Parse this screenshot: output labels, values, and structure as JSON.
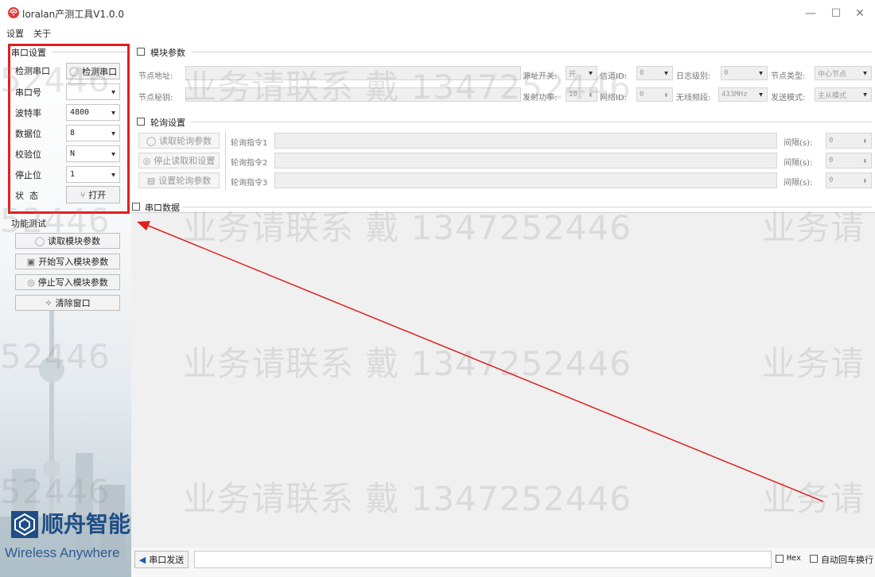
{
  "window": {
    "title": "loralan产测工具V1.0.0",
    "accent": "#e02020"
  },
  "menu": {
    "items": [
      "设置",
      "关于"
    ]
  },
  "serial_settings": {
    "title": "串口设置",
    "detect_label": "检测串口",
    "detect_button": "检测串口",
    "port_label": "串口号",
    "port_value": "",
    "baud_label": "波特率",
    "baud_value": "4800",
    "databits_label": "数据位",
    "databits_value": "8",
    "parity_label": "校验位",
    "parity_value": "N",
    "stopbits_label": "停止位",
    "stopbits_value": "1",
    "status_label": "状  态",
    "open_button": "打开"
  },
  "function_test": {
    "title": "功能测试",
    "read_params": "读取模块参数",
    "start_write": "开始写入模块参数",
    "stop_write": "停止写入模块参数",
    "clear_window": "清除窗口"
  },
  "module_params": {
    "title": "模块参数",
    "node_addr_label": "节点地址:",
    "node_key_label": "节点秘钥:",
    "source_switch_label": "源址开关:",
    "source_switch_value": "开",
    "channel_label": "信道ID:",
    "channel_value": "0",
    "log_level_label": "日志级别:",
    "log_level_value": "0",
    "node_type_label": "节点类型:",
    "node_type_value": "中心节点",
    "tx_power_label": "发射功率:",
    "tx_power_value": "10",
    "net_id_label": "网络ID:",
    "net_id_value": "0",
    "band_label": "无线频段:",
    "band_value": "433MHz",
    "send_mode_label": "发送模式:",
    "send_mode_value": "主从模式"
  },
  "polling": {
    "title": "轮询设置",
    "read_button": "读取轮询参数",
    "stop_button": "停止读取和设置",
    "set_button": "设置轮询参数",
    "cmd1_label": "轮询指令1",
    "cmd2_label": "轮询指令2",
    "cmd3_label": "轮询指令3",
    "interval_label": "间隔(s):",
    "interval1": "0",
    "interval2": "0",
    "interval3": "0"
  },
  "serial_data": {
    "title": "串口数据"
  },
  "send_bar": {
    "send_button": "串口发送",
    "hex_label": "Hex",
    "newline_label": "自动回车换行"
  },
  "watermark": {
    "text": "业务请联系 戴 1347252446",
    "left_fragment": "52446",
    "right_fragment": "业务请"
  },
  "logo": {
    "cn": "顺舟智能",
    "en": "Wireless Anywhere"
  },
  "icons": [
    "app-icon",
    "search-icon",
    "usb-icon",
    "monitor-icon",
    "stop-icon",
    "eraser-icon",
    "save-icon",
    "send-icon"
  ]
}
